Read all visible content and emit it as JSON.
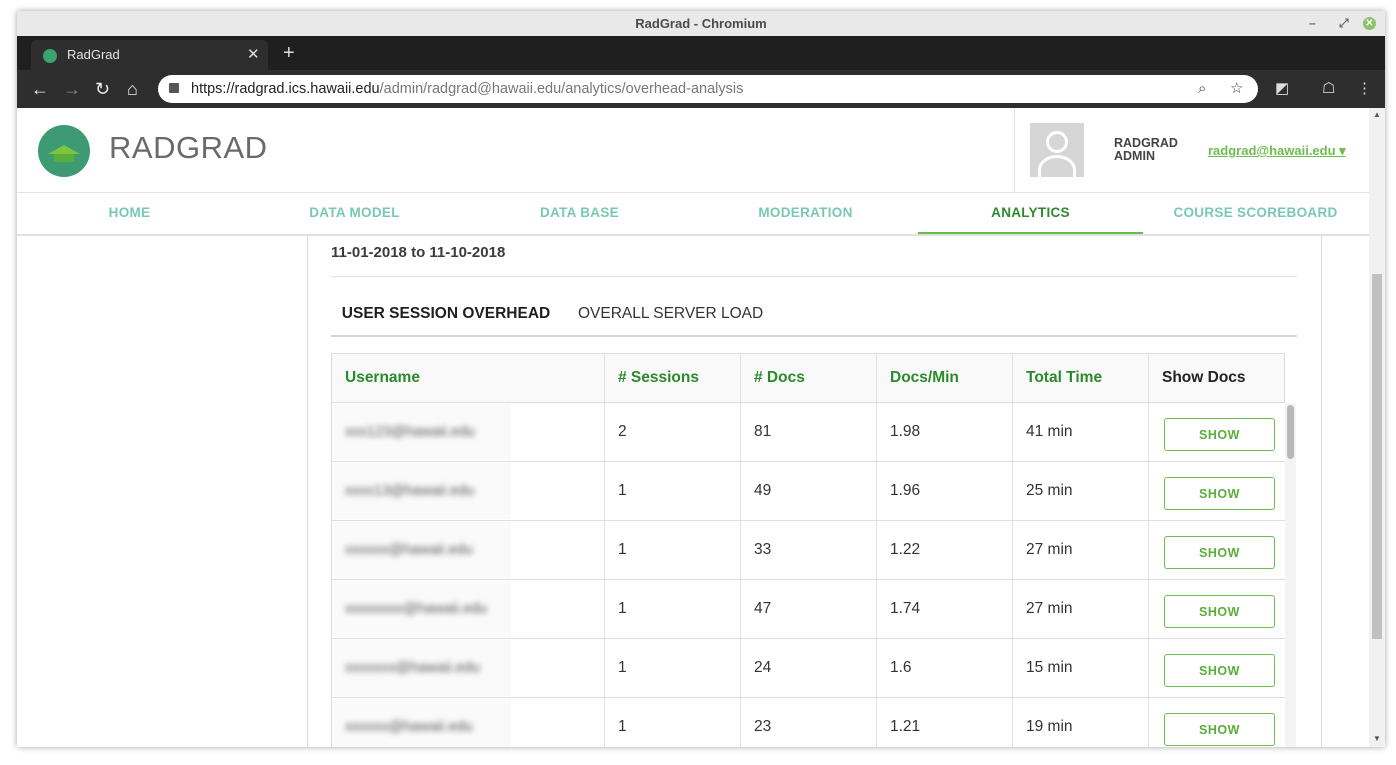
{
  "window": {
    "title": "RadGrad - Chromium"
  },
  "browser": {
    "tab_title": "RadGrad",
    "url_domain": "https://radgrad.ics.hawaii.edu",
    "url_path": "/admin/radgrad@hawaii.edu/analytics/overhead-analysis"
  },
  "header": {
    "brand_light": "RAD",
    "brand_dark": "GRAD",
    "role_line1": "RADGRAD",
    "role_line2": "ADMIN",
    "user_email": "radgrad@hawaii.edu ▾"
  },
  "menu": {
    "items": [
      {
        "label": "HOME"
      },
      {
        "label": "DATA MODEL"
      },
      {
        "label": "DATA BASE"
      },
      {
        "label": "MODERATION"
      },
      {
        "label": "ANALYTICS"
      },
      {
        "label": "COURSE SCOREBOARD"
      }
    ],
    "active": "ANALYTICS"
  },
  "content": {
    "date_range": "11-01-2018 to 11-10-2018",
    "tabs": [
      {
        "label": "USER SESSION OVERHEAD"
      },
      {
        "label": "OVERALL SERVER LOAD"
      }
    ],
    "active_tab": "USER SESSION OVERHEAD"
  },
  "table": {
    "headers": [
      "Username",
      "# Sessions",
      "# Docs",
      "Docs/Min",
      "Total Time",
      "Show Docs"
    ],
    "button_label": "SHOW",
    "rows": [
      {
        "username": "xxx123@hawaii.edu",
        "sessions": "2",
        "docs": "81",
        "docs_per_min": "1.98",
        "total_time": "41 min"
      },
      {
        "username": "xxxx13@hawaii.edu",
        "sessions": "1",
        "docs": "49",
        "docs_per_min": "1.96",
        "total_time": "25 min"
      },
      {
        "username": "xxxxxx@hawaii.edu",
        "sessions": "1",
        "docs": "33",
        "docs_per_min": "1.22",
        "total_time": "27 min"
      },
      {
        "username": "xxxxxxxx@hawaii.edu",
        "sessions": "1",
        "docs": "47",
        "docs_per_min": "1.74",
        "total_time": "27 min"
      },
      {
        "username": "xxxxxxx@hawaii.edu",
        "sessions": "1",
        "docs": "24",
        "docs_per_min": "1.6",
        "total_time": "15 min"
      },
      {
        "username": "xxxxxx@hawaii.edu",
        "sessions": "1",
        "docs": "23",
        "docs_per_min": "1.21",
        "total_time": "19 min"
      }
    ]
  },
  "colors": {
    "accent_green": "#6cbd4d",
    "menu_teal": "#79c8b4",
    "header_green": "#2c8a2c"
  }
}
